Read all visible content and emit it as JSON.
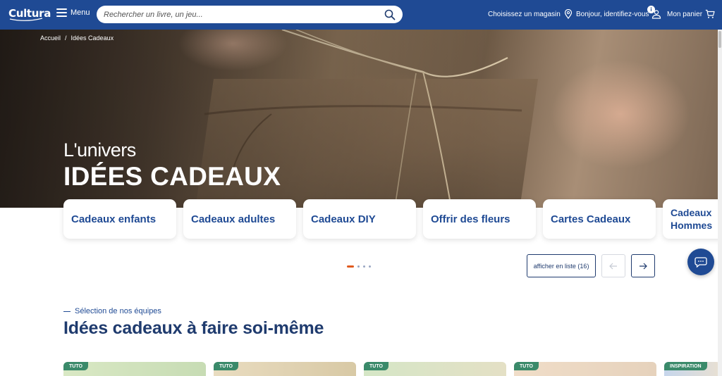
{
  "header": {
    "logo": "Cultura",
    "menu_label": "Menu",
    "search_placeholder": "Rechercher un livre, un jeu...",
    "store_label": "Choisissez un magasin",
    "account_label": "Bonjour, identifiez-vous",
    "account_badge": "i",
    "cart_label": "Mon panier",
    "brand_color": "#1f4a94"
  },
  "breadcrumb": {
    "home": "Accueil",
    "separator": "/",
    "current": "Idées Cadeaux"
  },
  "hero": {
    "kicker": "L'univers",
    "title": "IDÉES CADEAUX"
  },
  "categories": [
    {
      "label": "Cadeaux enfants"
    },
    {
      "label": "Cadeaux adultes"
    },
    {
      "label": "Cadeaux DIY"
    },
    {
      "label": "Offrir des fleurs"
    },
    {
      "label": "Cartes Cadeaux"
    },
    {
      "label": "Cadeaux Hommes"
    }
  ],
  "carousel": {
    "list_button": "afficher en liste (16)",
    "prev_icon": "arrow-left-icon",
    "next_icon": "arrow-right-icon",
    "pages": 4,
    "active_page": 1
  },
  "section": {
    "kicker": "Sélection de nos équipes",
    "title": "Idées cadeaux à faire soi-même"
  },
  "tiles": [
    {
      "tag": "TUTO"
    },
    {
      "tag": "TUTO"
    },
    {
      "tag": "TUTO"
    },
    {
      "tag": "TUTO"
    },
    {
      "tag": "INSPIRATION"
    }
  ],
  "chat": {
    "icon": "chat-bubble-icon"
  }
}
